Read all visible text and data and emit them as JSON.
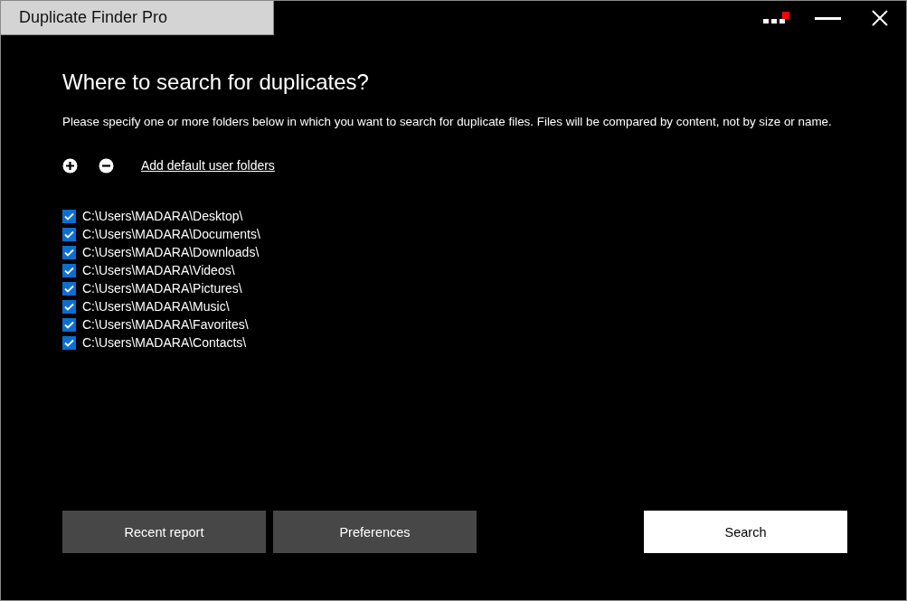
{
  "window": {
    "title": "Duplicate Finder Pro"
  },
  "heading": "Where to search for duplicates?",
  "description": "Please specify one or more folders below in which you want to search for duplicate files. Files will be compared by content, not by size or name.",
  "add_default_link": "Add default user folders",
  "folders": [
    {
      "path": "C:\\Users\\MADARA\\Desktop\\",
      "checked": true
    },
    {
      "path": "C:\\Users\\MADARA\\Documents\\",
      "checked": true
    },
    {
      "path": "C:\\Users\\MADARA\\Downloads\\",
      "checked": true
    },
    {
      "path": "C:\\Users\\MADARA\\Videos\\",
      "checked": true
    },
    {
      "path": "C:\\Users\\MADARA\\Pictures\\",
      "checked": true
    },
    {
      "path": "C:\\Users\\MADARA\\Music\\",
      "checked": true
    },
    {
      "path": "C:\\Users\\MADARA\\Favorites\\",
      "checked": true
    },
    {
      "path": "C:\\Users\\MADARA\\Contacts\\",
      "checked": true
    }
  ],
  "buttons": [
    {
      "label": "Recent report",
      "kind": "secondary"
    },
    {
      "label": "Preferences",
      "kind": "secondary"
    },
    {
      "label": "Search",
      "kind": "primary"
    }
  ]
}
